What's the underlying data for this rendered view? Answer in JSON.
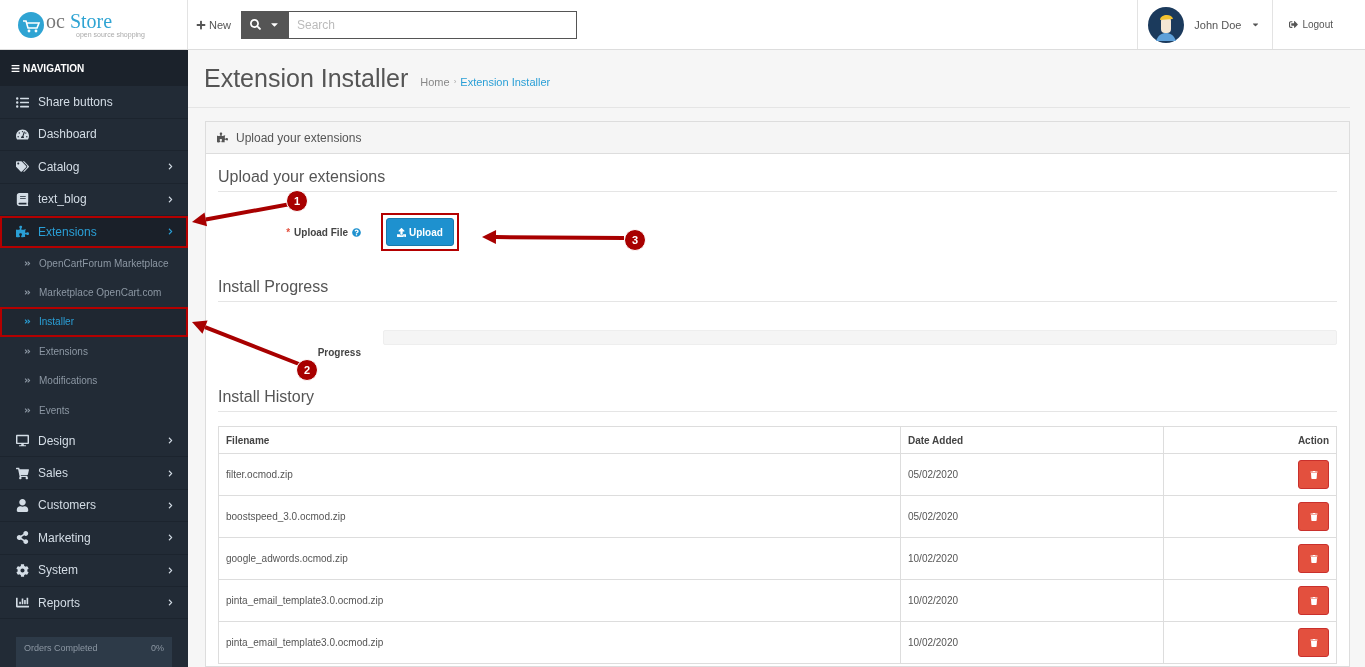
{
  "header": {
    "logo": {
      "prefix": "oc",
      "name": "Store",
      "tagline": "open source shopping"
    },
    "new_button": "New",
    "search": {
      "placeholder": "Search"
    },
    "user": {
      "name": "John Doe"
    },
    "logout": "Logout"
  },
  "sidebar": {
    "heading": "NAVIGATION",
    "items": [
      {
        "label": "Share buttons",
        "has_children": false,
        "selected": false,
        "highlighted": false
      },
      {
        "label": "Dashboard",
        "has_children": false,
        "selected": false,
        "highlighted": false
      },
      {
        "label": "Catalog",
        "has_children": true,
        "selected": false,
        "highlighted": false
      },
      {
        "label": "text_blog",
        "has_children": true,
        "selected": false,
        "highlighted": false
      },
      {
        "label": "Extensions",
        "has_children": true,
        "selected": true,
        "highlighted": true,
        "expanded": true,
        "children": [
          {
            "label": "OpenCartForum Marketplace",
            "selected": false,
            "highlighted": false
          },
          {
            "label": "Marketplace OpenCart.com",
            "selected": false,
            "highlighted": false
          },
          {
            "label": "Installer",
            "selected": true,
            "highlighted": true
          },
          {
            "label": "Extensions",
            "selected": false,
            "highlighted": false
          },
          {
            "label": "Modifications",
            "selected": false,
            "highlighted": false
          },
          {
            "label": "Events",
            "selected": false,
            "highlighted": false
          }
        ]
      },
      {
        "label": "Design",
        "has_children": true,
        "selected": false,
        "highlighted": false
      },
      {
        "label": "Sales",
        "has_children": true,
        "selected": false,
        "highlighted": false
      },
      {
        "label": "Customers",
        "has_children": true,
        "selected": false,
        "highlighted": false
      },
      {
        "label": "Marketing",
        "has_children": true,
        "selected": false,
        "highlighted": false
      },
      {
        "label": "System",
        "has_children": true,
        "selected": false,
        "highlighted": false
      },
      {
        "label": "Reports",
        "has_children": true,
        "selected": false,
        "highlighted": false
      }
    ],
    "stats": {
      "label": "Orders Completed",
      "value": "0%"
    }
  },
  "page": {
    "title": "Extension Installer",
    "breadcrumb": [
      {
        "label": "Home",
        "current": false
      },
      {
        "label": "Extension Installer",
        "current": true
      }
    ],
    "breadcrumb_separator": "›",
    "panel_heading": "Upload your extensions",
    "upload_section": {
      "legend": "Upload your extensions",
      "label": "Upload File",
      "required_mark": "*",
      "button": "Upload",
      "highlighted": true
    },
    "progress_section": {
      "legend": "Install Progress",
      "label": "Progress",
      "level": 0
    },
    "history_section": {
      "legend": "Install History",
      "columns": [
        "Filename",
        "Date Added",
        "Action"
      ],
      "rows": [
        {
          "filename": "filter.ocmod.zip",
          "date": "05/02/2020"
        },
        {
          "filename": "boostspeed_3.0.ocmod.zip",
          "date": "05/02/2020"
        },
        {
          "filename": "google_adwords.ocmod.zip",
          "date": "10/02/2020"
        },
        {
          "filename": "pinta_email_template3.0.ocmod.zip",
          "date": "10/02/2020"
        },
        {
          "filename": "pinta_email_template3.0.ocmod.zip",
          "date": "10/02/2020"
        }
      ]
    }
  },
  "annotations": [
    {
      "number": "1"
    },
    {
      "number": "2"
    },
    {
      "number": "3"
    }
  ]
}
